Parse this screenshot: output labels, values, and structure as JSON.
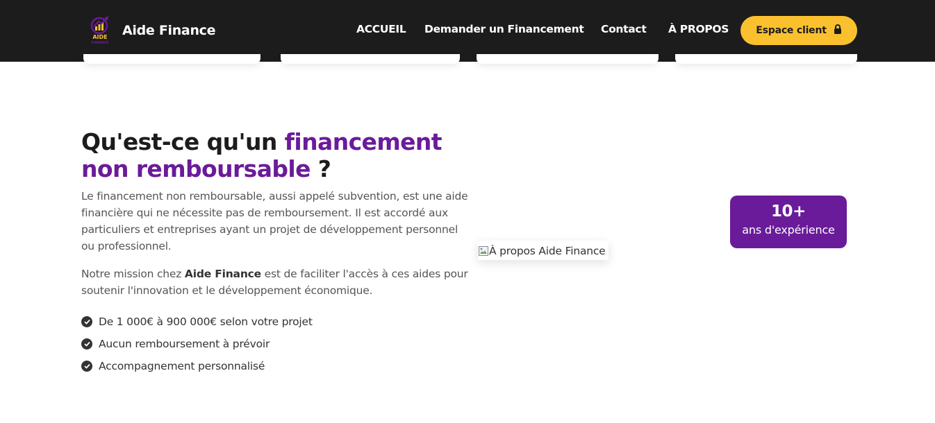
{
  "header": {
    "brand_name": "Aide Finance",
    "logo_text_top": "AIDE",
    "logo_text_bottom": "FINANCE",
    "nav": [
      "ACCUEIL",
      "Demander un Financement",
      "Contact",
      "À PROPOS"
    ],
    "cta_label": "Espace client",
    "cta_icon": "lock-icon"
  },
  "about": {
    "title_part1": "Qu'est-ce qu'un ",
    "title_accent": "financement non remboursable",
    "title_part2": " ?",
    "paragraph1": "Le financement non remboursable, aussi appelé subvention, est une aide financière qui ne nécessite pas de remboursement. Il est accordé aux particuliers et entreprises ayant un projet de développement personnel ou professionnel.",
    "paragraph2_before": "Notre mission chez ",
    "paragraph2_bold": "Aide Finance",
    "paragraph2_after": " est de faciliter l'accès à ces aides pour soutenir l'innovation et le développement économique.",
    "features": [
      "De 1 000€ à 900 000€ selon votre projet",
      "Aucun remboursement à prévoir",
      "Accompagnement personnalisé"
    ],
    "image_alt": "À propos Aide Finance",
    "badge_number": "10+",
    "badge_label": "ans d'expérience"
  },
  "colors": {
    "header_bg": "#1c1c1c",
    "accent_purple": "#6a1b9a",
    "cta_yellow": "#fbc02d",
    "body_text": "#555555"
  }
}
